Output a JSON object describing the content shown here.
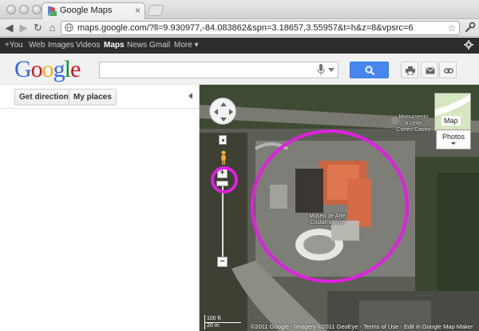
{
  "browser": {
    "tab_title": "Google Maps",
    "tab_close": "×",
    "url": "maps.google.com/?ll=9.930977,-84.083862&spn=3.18657,3.55957&t=h&z=8&vpsrc=6",
    "back": "◀",
    "forward": "▶",
    "reload": "↻",
    "home": "⌂",
    "star": "☆"
  },
  "gbar": {
    "items": [
      "+You",
      "Web",
      "Images",
      "Videos",
      "Maps",
      "News",
      "Gmail",
      "More ▾"
    ],
    "active_index": 4
  },
  "header": {
    "logo_letters": [
      "G",
      "o",
      "o",
      "g",
      "l",
      "e"
    ],
    "logo_colors": [
      "#3369e8",
      "#d50f25",
      "#eeb211",
      "#3369e8",
      "#009925",
      "#d50f25"
    ],
    "search_value": "",
    "accent": "#4787ed"
  },
  "sidebar": {
    "get_directions": "Get directions",
    "my_places": "My places"
  },
  "map": {
    "labels": {
      "monument": "Monumento\na León\nCortés Castro",
      "museum": "Museo de Arte\nCostarricense"
    },
    "map_toggle": "Map",
    "photos_toggle": "Photos",
    "zoom_in": "+",
    "zoom_out": "−",
    "scale_ft": "100 ft",
    "scale_m": "20 m",
    "copyright": "©2011 Google - Imagery ©2011 GeoEye - Terms of Use - Edit in Google Map Maker",
    "highlight_color": "#e11fe0"
  }
}
